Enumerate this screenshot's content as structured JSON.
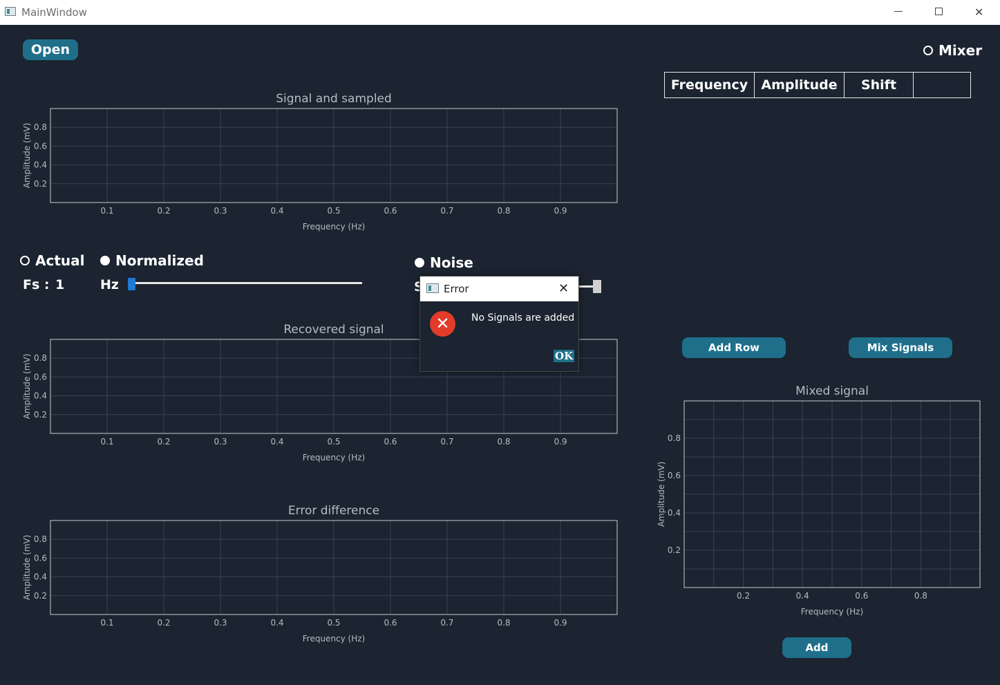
{
  "window": {
    "title": "MainWindow",
    "min_glyph": "",
    "max_glyph": "",
    "close_glyph": "✕"
  },
  "buttons": {
    "open": "Open",
    "add_row": "Add Row",
    "mix_signals": "Mix Signals",
    "add": "Add"
  },
  "radios": {
    "mixer": "Mixer",
    "actual": "Actual",
    "normalized": "Normalized",
    "noise": "Noise"
  },
  "sampling": {
    "fs_label": "Fs :",
    "fs_value": "1",
    "hz_label": "Hz",
    "slider_level": 0.0
  },
  "noise": {
    "partial_label": "S"
  },
  "table": {
    "headers": [
      "Frequency",
      "Amplitude",
      "Shift",
      ""
    ]
  },
  "dialog": {
    "title": "Error",
    "message": "No Signals are added",
    "ok": "OK",
    "close_glyph": "✕",
    "icon_glyph": "✕"
  },
  "colors": {
    "background": "#1b2430",
    "button": "#1f6f8b",
    "slider_accent": "#1f78d1",
    "error_red": "#e23b2a"
  },
  "chart_data": [
    {
      "type": "line",
      "title": "Signal and sampled",
      "xlabel": "Frequency (Hz)",
      "ylabel": "Amplitude (mV)",
      "xticks": [
        "0.1",
        "0.2",
        "0.3",
        "0.4",
        "0.5",
        "0.6",
        "0.7",
        "0.8",
        "0.9"
      ],
      "yticks": [
        "0.8",
        "0.6",
        "0.4",
        "0.2"
      ],
      "xlim": [
        0,
        1
      ],
      "ylim": [
        0,
        1
      ],
      "series": [],
      "grid": true
    },
    {
      "type": "line",
      "title": "Recovered signal",
      "xlabel": "Frequency (Hz)",
      "ylabel": "Amplitude (mV)",
      "xticks": [
        "0.1",
        "0.2",
        "0.3",
        "0.4",
        "0.5",
        "0.6",
        "0.7",
        "0.8",
        "0.9"
      ],
      "yticks": [
        "0.8",
        "0.6",
        "0.4",
        "0.2"
      ],
      "xlim": [
        0,
        1
      ],
      "ylim": [
        0,
        1
      ],
      "series": [],
      "grid": true
    },
    {
      "type": "line",
      "title": "Error difference",
      "xlabel": "Frequency (Hz)",
      "ylabel": "Amplitude (mV)",
      "xticks": [
        "0.1",
        "0.2",
        "0.3",
        "0.4",
        "0.5",
        "0.6",
        "0.7",
        "0.8",
        "0.9"
      ],
      "yticks": [
        "0.8",
        "0.6",
        "0.4",
        "0.2"
      ],
      "xlim": [
        0,
        1
      ],
      "ylim": [
        0,
        1
      ],
      "series": [],
      "grid": true
    },
    {
      "type": "line",
      "title": "Mixed signal",
      "xlabel": "Frequency (Hz)",
      "ylabel": "Amplitude (mV)",
      "xticks": [
        "0.2",
        "0.4",
        "0.6",
        "0.8"
      ],
      "yticks": [
        "0.8",
        "0.6",
        "0.4",
        "0.2"
      ],
      "xlim": [
        0,
        1
      ],
      "ylim": [
        0,
        1
      ],
      "series": [],
      "grid": true
    }
  ]
}
